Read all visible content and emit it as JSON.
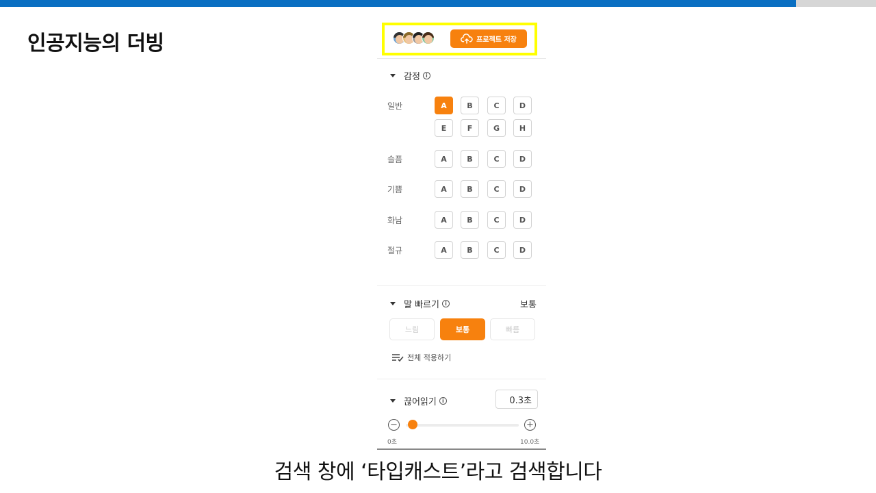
{
  "slide": {
    "title": "인공지능의 더빙",
    "caption": "검색 창에 ‘타입캐스트’라고 검색합니다"
  },
  "colors": {
    "accent": "#f7810e",
    "top_bar": "#0a6fc2",
    "highlight": "#ffff00"
  },
  "header": {
    "save_label": "프로젝트 저장",
    "save_icon": "cloud-upload-icon",
    "avatars": [
      "avatar-1",
      "avatar-2",
      "avatar-3",
      "avatar-4"
    ]
  },
  "emotion": {
    "title": "감정",
    "info_icon": "i",
    "groups": [
      {
        "label": "일반",
        "options": [
          "A",
          "B",
          "C",
          "D",
          "E",
          "F",
          "G",
          "H"
        ],
        "selected": "A"
      },
      {
        "label": "슬픔",
        "options": [
          "A",
          "B",
          "C",
          "D"
        ]
      },
      {
        "label": "기쁨",
        "options": [
          "A",
          "B",
          "C",
          "D"
        ]
      },
      {
        "label": "화남",
        "options": [
          "A",
          "B",
          "C",
          "D"
        ]
      },
      {
        "label": "절규",
        "options": [
          "A",
          "B",
          "C",
          "D"
        ]
      }
    ]
  },
  "speed": {
    "title": "말 빠르기",
    "info_icon": "i",
    "current": "보통",
    "options": [
      "느림",
      "보통",
      "빠름"
    ],
    "selected": "보통",
    "apply_all": "전체 적용하기"
  },
  "pause": {
    "title": "끊어읽기",
    "info_icon": "i",
    "value_label": "0.3초",
    "value": 0.3,
    "min_label": "0초",
    "max_label": "10.0초",
    "min": 0,
    "max": 10.0
  }
}
